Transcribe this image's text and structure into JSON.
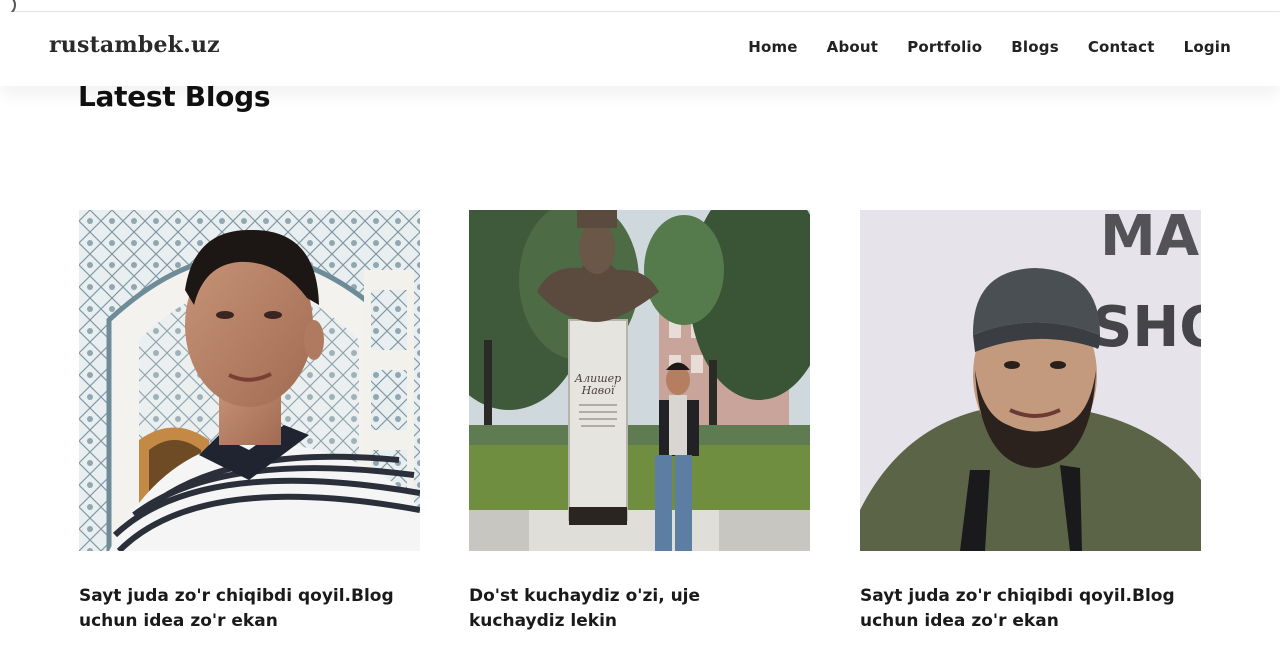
{
  "header": {
    "brand": "rustambek.uz",
    "nav": [
      "Home",
      "About",
      "Portfolio",
      "Blogs",
      "Contact",
      "Login"
    ]
  },
  "main": {
    "title": "Latest Blogs",
    "posts": [
      {
        "caption": "Sayt juda zo'r chiqibdi qoyil.Blog uchun idea zo'r ekan",
        "image": "photo-man-mosque-selfie"
      },
      {
        "caption": "Do'st kuchaydiz o'zi, uje kuchaydiz lekin",
        "image": "photo-man-monument-park"
      },
      {
        "caption": "Sayt juda zo'r chiqibdi qoyil.Blog uchun idea zo'r ekan",
        "image": "photo-man-cap-hoodie"
      }
    ],
    "monument_text": [
      "Алишер",
      "Навої"
    ],
    "backdrop_text": [
      "MA",
      "SHO"
    ]
  },
  "colors": {
    "text": "#111111",
    "background": "#ffffff"
  }
}
